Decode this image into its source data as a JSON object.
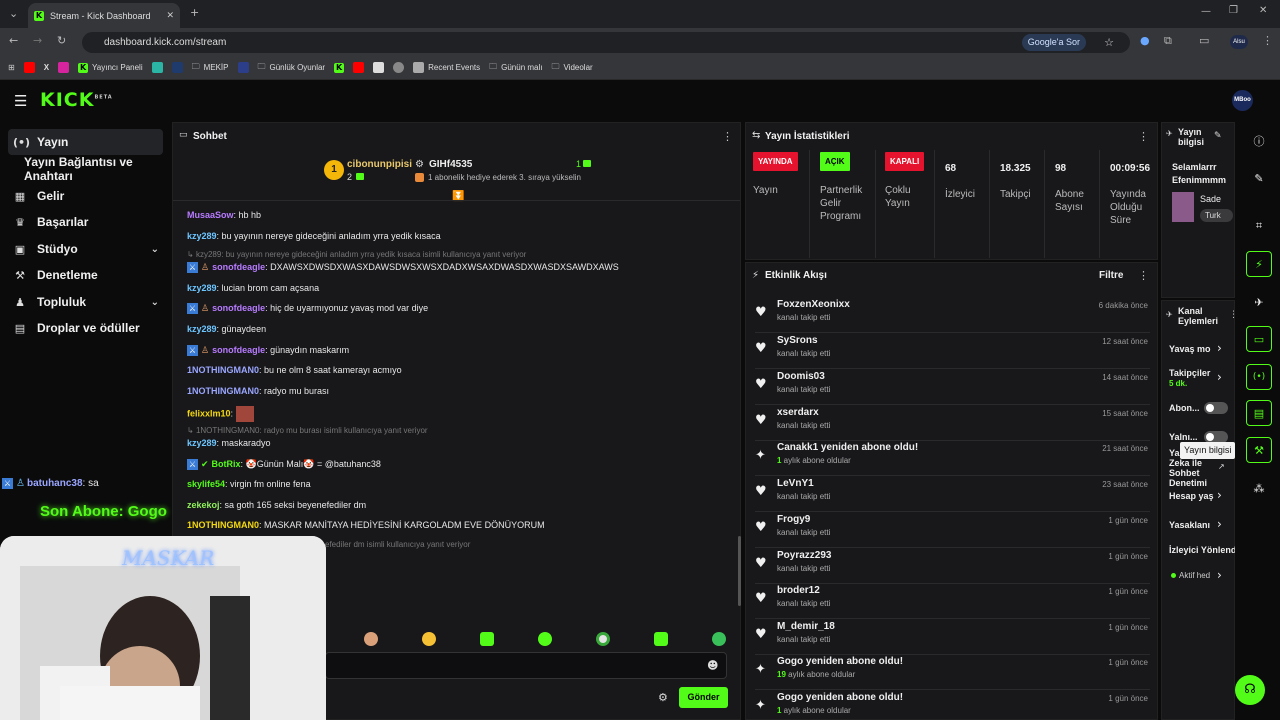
{
  "browser": {
    "tab_title": "Stream - Kick Dashboard",
    "url": "dashboard.kick.com/stream",
    "ask_google": "Google'a Sor",
    "profile_label": "Alsu",
    "bookmarks": [
      "Yayıncı Paneli",
      "MEKİP",
      "Günlük Oyunlar",
      "Recent Events",
      "Günün malı",
      "Videolar"
    ]
  },
  "app": {
    "logo": "KICK",
    "logo_badge": "BETA",
    "avatar_label": "MBoo"
  },
  "sidebar": {
    "items": [
      {
        "label": "Yayın",
        "icon": "broadcast-icon"
      },
      {
        "label": "Yayın Bağlantısı ve Anahtarı"
      },
      {
        "label": "Gelir",
        "icon": "revenue-icon"
      },
      {
        "label": "Başarılar",
        "icon": "trophy-icon"
      },
      {
        "label": "Stüdyo",
        "icon": "studio-icon"
      },
      {
        "label": "Denetleme",
        "icon": "wrench-icon"
      },
      {
        "label": "Topluluk",
        "icon": "community-icon"
      },
      {
        "label": "Droplar ve ödüller",
        "icon": "gift-icon"
      }
    ]
  },
  "chat": {
    "title": "Sohbet",
    "pinned_user1": "cibonunpipisi",
    "pinned_count1": "2",
    "pinned_user2": "GIHf4535",
    "pinned_count2": "1",
    "pinned_note": "1 abonelik hediye ederek 3. sıraya yükselin",
    "rank": "1",
    "messages": [
      {
        "user": "MusaaSow",
        "text": ": hb hb"
      },
      {
        "user": "kzy289",
        "text": ": bu yayının nereye gideceğini anladım yrra yedik kısaca"
      },
      {
        "reply": "kzy289: bu yayının nereye gideceğini anladım yrra yedik kısaca isimli kullanıcıya yanıt veriyor"
      },
      {
        "user": "sonofdeagle",
        "text": ": DXAWSXDWSDXWASXDAWSDWSXWSXDADXWSAXDWASDXWASDXSAWDXAWS"
      },
      {
        "user": "kzy289",
        "text": ": lucian brom cam açsana"
      },
      {
        "user": "sonofdeagle",
        "text": ": hiç de uyarmıyonuz yavaş mod var diye"
      },
      {
        "user": "kzy289",
        "text": ": günaydeen"
      },
      {
        "user": "sonofdeagle",
        "text": ": günaydın maskarım"
      },
      {
        "user": "1NOTHINGMAN0",
        "text": ": bu ne olm 8 saat kamerayı acmıyo"
      },
      {
        "user": "1NOTHINGMAN0",
        "text": ": radyo mu burası"
      },
      {
        "user": "felixxlm10",
        "text": ":"
      },
      {
        "reply": "1NOTHINGMAN0: radyo mu burası isimli kullanıcıya yanıt veriyor"
      },
      {
        "user": "kzy289",
        "text": ": maskaradyo"
      },
      {
        "user": "BotRix",
        "text": ": 🤡Günün Malı🤡 = @batuhanc38"
      },
      {
        "user": "skylife54",
        "text": ": virgin fm online fena"
      },
      {
        "user": "zekekoj",
        "text": ": sa goth 165 seksi beyenefediler dm"
      },
      {
        "user": "1NOTHINGMAN0",
        "text": ": MASKAR MANİTAYA HEDİYESİNİ KARGOLADM EVE DÖNÜYORUM"
      },
      {
        "reply": "efediler dm isimli kullanıcıya yanıt veriyor"
      }
    ],
    "send_label": "Gönder"
  },
  "overlay": {
    "chat_user": "batuhanc38",
    "chat_text": ": sa",
    "sub_text": "Son Abone: Gogo",
    "cam_text": "MASKAR"
  },
  "stats": {
    "title": "Yayın İstatistikleri",
    "live_tag": "YAYINDA",
    "live_label": "Yayın",
    "open_tag": "AÇIK",
    "open_label": [
      "Partnerlik",
      "Gelir",
      "Programı"
    ],
    "closed_tag": "KAPALI",
    "closed_label": [
      "Çoklu",
      "Yayın"
    ],
    "viewers_val": "68",
    "viewers_label": "İzleyici",
    "followers_val": "18.325",
    "followers_label": "Takipçi",
    "subs_val": "98",
    "subs_label": [
      "Abone",
      "Sayısı"
    ],
    "uptime_val": "00:09:56",
    "uptime_label": [
      "Yayında",
      "Olduğu",
      "Süre"
    ]
  },
  "activity": {
    "title": "Etkinlik Akışı",
    "filter": "Filtre",
    "events": [
      {
        "name": "FoxzenXeonixx",
        "sub": "kanalı takip etti",
        "time": "6 dakika önce",
        "icon": "heart-icon"
      },
      {
        "name": "SySrons",
        "sub": "kanalı takip etti",
        "time": "12 saat önce",
        "icon": "heart-icon"
      },
      {
        "name": "Doomis03",
        "sub": "kanalı takip etti",
        "time": "14 saat önce",
        "icon": "heart-icon"
      },
      {
        "name": "xserdarx",
        "sub": "kanalı takip etti",
        "time": "15 saat önce",
        "icon": "heart-icon"
      },
      {
        "name": "Canakk1 yeniden abone oldu!",
        "sub_num": "1",
        "sub": " aylık abone oldular",
        "time": "21 saat önce",
        "icon": "sparkle-icon"
      },
      {
        "name": "LeVnY1",
        "sub": "kanalı takip etti",
        "time": "23 saat önce",
        "icon": "heart-icon"
      },
      {
        "name": "Frogy9",
        "sub": "kanalı takip etti",
        "time": "1 gün önce",
        "icon": "heart-icon"
      },
      {
        "name": "Poyrazz293",
        "sub": "kanalı takip etti",
        "time": "1 gün önce",
        "icon": "heart-icon"
      },
      {
        "name": "broder12",
        "sub": "kanalı takip etti",
        "time": "1 gün önce",
        "icon": "heart-icon"
      },
      {
        "name": "M_demir_18",
        "sub": "kanalı takip etti",
        "time": "1 gün önce",
        "icon": "heart-icon"
      },
      {
        "name": "Gogo yeniden abone oldu!",
        "sub_num": "19",
        "sub": " aylık abone oldular",
        "time": "1 gün önce",
        "icon": "sparkle-icon"
      },
      {
        "name": "Gogo yeniden abone oldu!",
        "sub_num": "1",
        "sub": " aylık abone oldular",
        "time": "1 gün önce",
        "icon": "sparkle-icon"
      }
    ]
  },
  "stream_info": {
    "title": [
      "Yayın",
      "bilgisi"
    ],
    "stream_title": [
      "Selamlarrr",
      "Efenimmmm"
    ],
    "category": "Sade",
    "language": "Turk"
  },
  "channel_actions": {
    "title": [
      "Kanal",
      "Eylemleri"
    ],
    "items": [
      "Yavaş mo",
      "Takipçiler",
      "Abon...",
      "Yalnı...",
      "Yapay",
      "Zeka ile",
      "Sohbet",
      "Denetimi",
      "Hesap yaş",
      "Yasaklanı",
      "İzleyici Yönlend",
      "Aktif hed"
    ],
    "followers_sub": "5 dk."
  },
  "tooltip": "Yayın bilgisi"
}
